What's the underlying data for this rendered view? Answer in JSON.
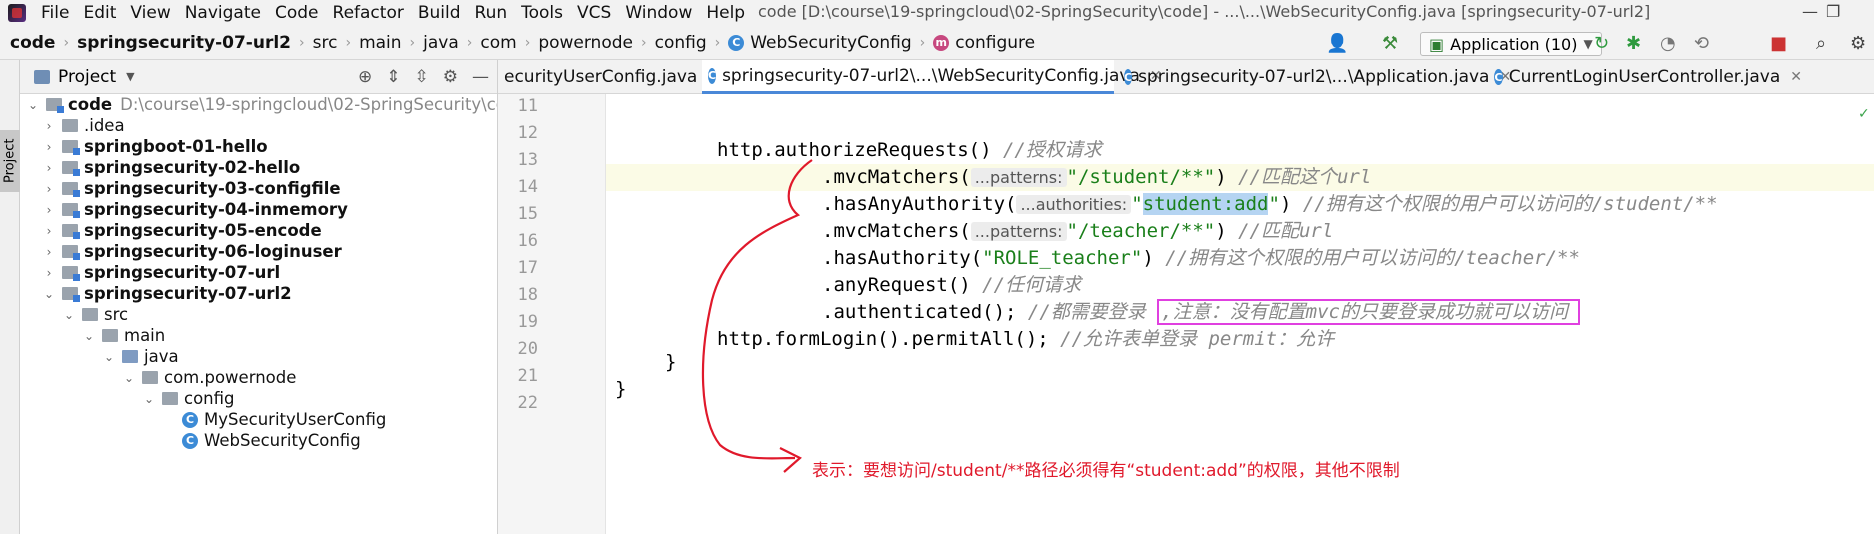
{
  "window": {
    "title": "code [D:\\course\\19-springcloud\\02-SpringSecurity\\code] - ...\\...\\WebSecurityConfig.java [springsecurity-07-url2]",
    "menu": [
      "File",
      "Edit",
      "View",
      "Navigate",
      "Code",
      "Refactor",
      "Build",
      "Run",
      "Tools",
      "VCS",
      "Window",
      "Help"
    ]
  },
  "breadcrumb": [
    "code",
    "springsecurity-07-url2",
    "src",
    "main",
    "java",
    "com",
    "powernode",
    "config",
    "WebSecurityConfig",
    "configure"
  ],
  "toolbar": {
    "run_config": "Application (10)"
  },
  "project_panel": {
    "title": "Project",
    "strip_label": "Project",
    "root": {
      "name": "code",
      "path": "D:\\course\\19-springcloud\\02-SpringSecurity\\code"
    },
    "items": [
      {
        "label": ".idea",
        "bold": false
      },
      {
        "label": "springboot-01-hello",
        "bold": true
      },
      {
        "label": "springsecurity-02-hello",
        "bold": true
      },
      {
        "label": "springsecurity-03-configfile",
        "bold": true
      },
      {
        "label": "springsecurity-04-inmemory",
        "bold": true
      },
      {
        "label": "springsecurity-05-encode",
        "bold": true
      },
      {
        "label": "springsecurity-06-loginuser",
        "bold": true
      },
      {
        "label": "springsecurity-07-url",
        "bold": true
      },
      {
        "label": "springsecurity-07-url2",
        "bold": true
      },
      {
        "label": "src"
      },
      {
        "label": "main"
      },
      {
        "label": "java"
      },
      {
        "label": "com.powernode"
      },
      {
        "label": "config"
      },
      {
        "label": "MySecurityUserConfig"
      },
      {
        "label": "WebSecurityConfig"
      }
    ]
  },
  "tabs": [
    {
      "label": "ecurityUserConfig.java"
    },
    {
      "label": "springsecurity-07-url2\\...\\WebSecurityConfig.java"
    },
    {
      "label": "springsecurity-07-url2\\...\\Application.java"
    },
    {
      "label": "CurrentLoginUserController.java"
    }
  ],
  "editor": {
    "line_numbers": [
      "11",
      "12",
      "13",
      "14",
      "15",
      "16",
      "17",
      "18",
      "19",
      "20",
      "21",
      "22"
    ],
    "lines": {
      "l12_code": "http.authorizeRequests() ",
      "l12_comment": "//授权请求",
      "l13_code": ".mvcMatchers(",
      "l13_hint": "...patterns:",
      "l13_str": "\"/student/**\"",
      "l13_end": ") ",
      "l13_comment": "//匹配这个url",
      "l14_code": ".hasAnyAuthority(",
      "l14_hint": "...authorities:",
      "l14_q1": "\"",
      "l14_sel": "student:add",
      "l14_q2": "\"",
      "l14_end": ") ",
      "l14_comment": "//拥有这个权限的用户可以访问的/student/**",
      "l15_code": ".mvcMatchers(",
      "l15_hint": "...patterns:",
      "l15_str": "\"/teacher/**\"",
      "l15_end": ") ",
      "l15_comment": "//匹配url",
      "l16_code": ".hasAuthority(",
      "l16_str": "\"ROLE_teacher\"",
      "l16_end": ") ",
      "l16_comment": "//拥有这个权限的用户可以访问的/teacher/**",
      "l17_code": ".anyRequest() ",
      "l17_comment": "//任何请求",
      "l18_code": ".authenticated(); ",
      "l18_comment": "//都需要登录 ",
      "l18_boxed": ",注意：没有配置mvc的只要登录成功就可以访问",
      "l19_code": "http.formLogin().permitAll(); ",
      "l19_comment": "//允许表单登录 permit：允许",
      "l20_code": "}",
      "l21_code": "}"
    }
  },
  "annotation": {
    "note": "表示：要想访问/student/**路径必须得有“student:add”的权限，其他不限制",
    "color": "#e0192b",
    "box_color": "#e040e0"
  }
}
